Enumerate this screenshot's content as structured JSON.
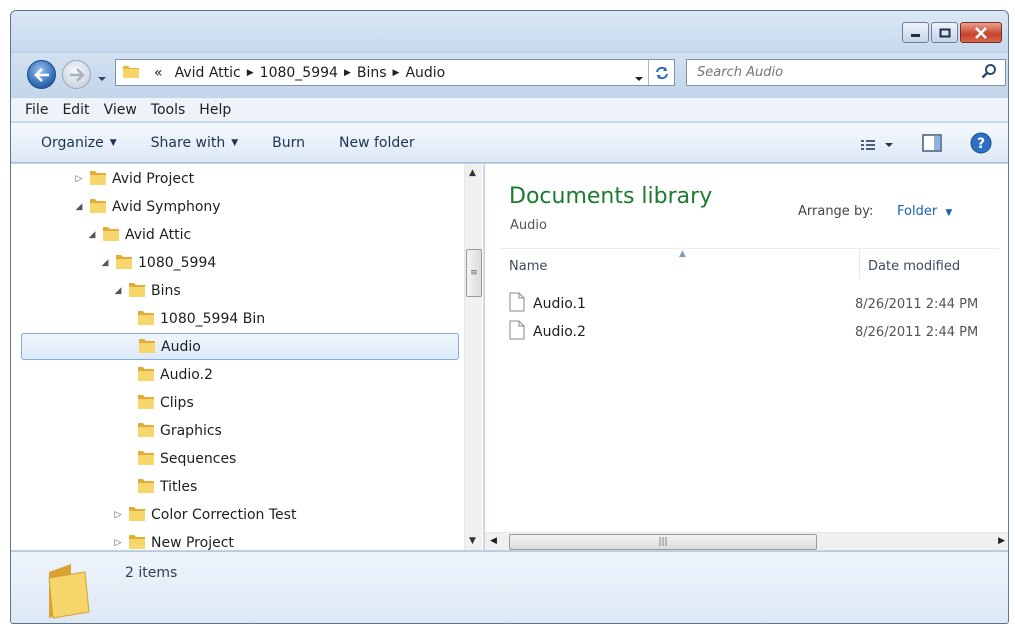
{
  "window": {
    "caption_buttons": [
      "minimize",
      "maximize",
      "close"
    ]
  },
  "address": {
    "overflow": "«",
    "crumbs": [
      "Avid Attic",
      "1080_5994",
      "Bins",
      "Audio"
    ]
  },
  "search": {
    "placeholder": "Search Audio"
  },
  "menu": [
    "File",
    "Edit",
    "View",
    "Tools",
    "Help"
  ],
  "toolbar": {
    "organize": "Organize",
    "share_with": "Share with",
    "burn": "Burn",
    "new_folder": "New folder"
  },
  "tree": [
    {
      "label": "Avid Project",
      "level": 0,
      "state": "collapsed"
    },
    {
      "label": "Avid Symphony",
      "level": 0,
      "state": "expanded"
    },
    {
      "label": "Avid Attic",
      "level": 1,
      "state": "expanded"
    },
    {
      "label": "1080_5994",
      "level": 2,
      "state": "expanded"
    },
    {
      "label": "Bins",
      "level": 3,
      "state": "expanded"
    },
    {
      "label": "1080_5994 Bin",
      "level": 4,
      "state": "leaf"
    },
    {
      "label": "Audio",
      "level": 4,
      "state": "leaf",
      "selected": true
    },
    {
      "label": "Audio.2",
      "level": 4,
      "state": "leaf"
    },
    {
      "label": "Clips",
      "level": 4,
      "state": "leaf"
    },
    {
      "label": "Graphics",
      "level": 4,
      "state": "leaf"
    },
    {
      "label": "Sequences",
      "level": 4,
      "state": "leaf"
    },
    {
      "label": "Titles",
      "level": 4,
      "state": "leaf"
    },
    {
      "label": "Color Correction Test",
      "level": 3,
      "state": "collapsed"
    },
    {
      "label": "New Project",
      "level": 3,
      "state": "collapsed"
    }
  ],
  "library": {
    "title": "Documents library",
    "subtitle": "Audio",
    "arrange_label": "Arrange by:",
    "arrange_value": "Folder"
  },
  "columns": {
    "name": "Name",
    "date": "Date modified"
  },
  "files": [
    {
      "name": "Audio.1",
      "date": "8/26/2011 2:44 PM"
    },
    {
      "name": "Audio.2",
      "date": "8/26/2011 2:44 PM"
    }
  ],
  "status": {
    "count": "2 items"
  },
  "colors": {
    "title_green": "#1a7c2c",
    "link_blue": "#1a5fb4",
    "selection": "#dbe9f9"
  }
}
